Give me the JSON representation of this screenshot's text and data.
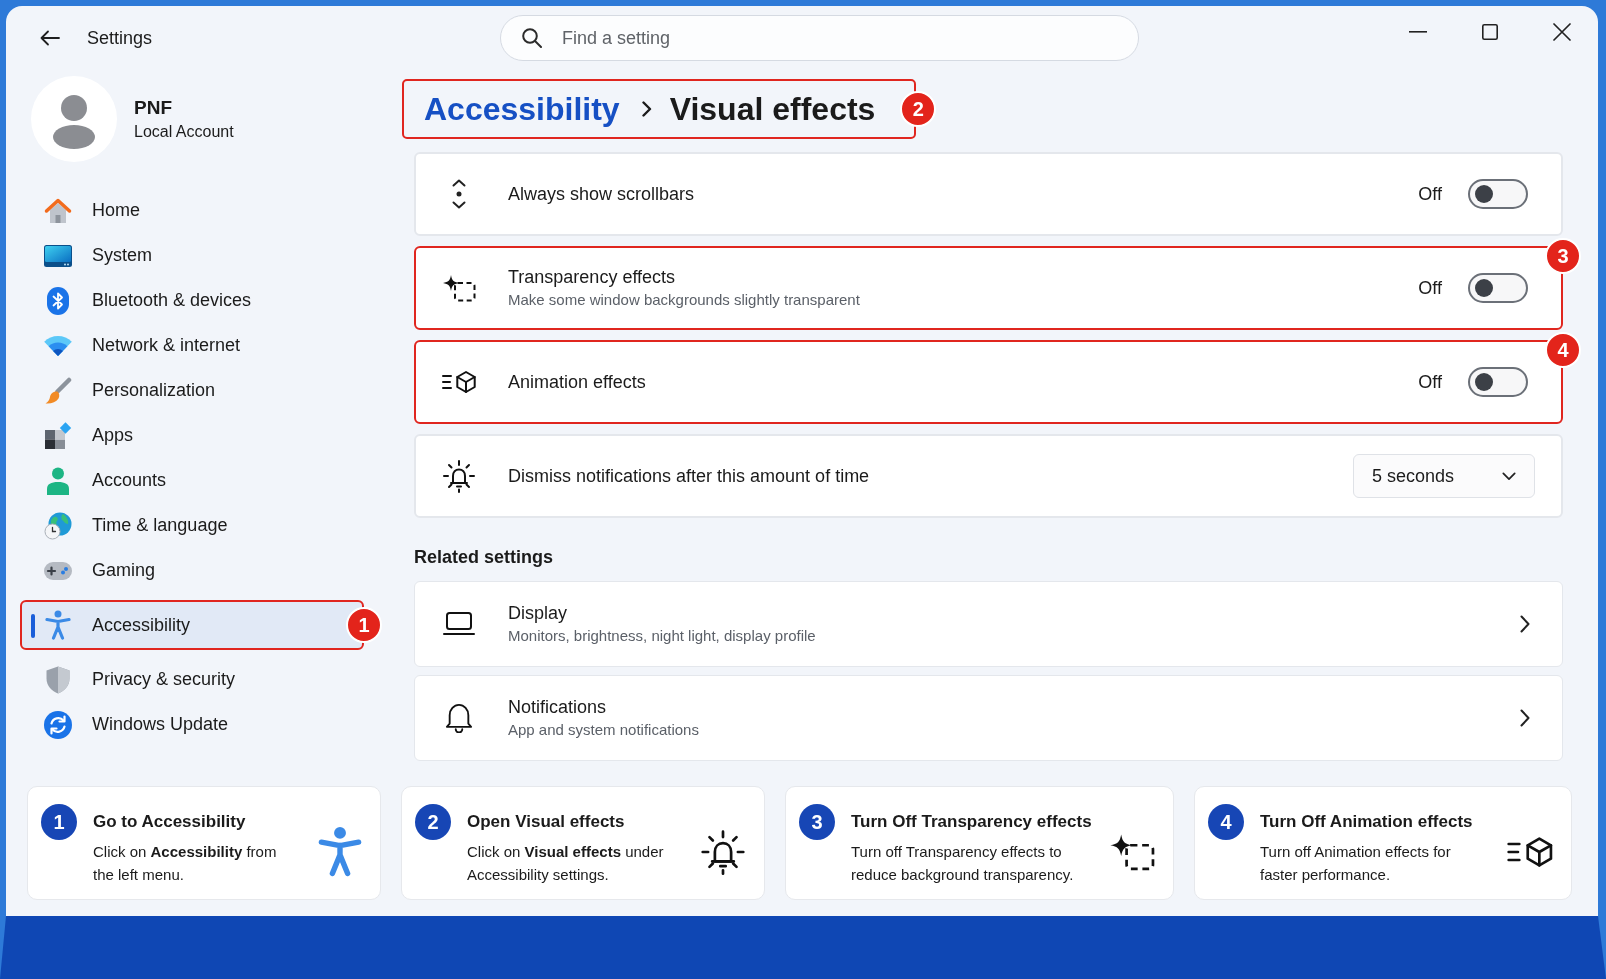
{
  "window": {
    "title": "Settings"
  },
  "search": {
    "placeholder": "Find a setting"
  },
  "account": {
    "name": "PNF",
    "type": "Local Account"
  },
  "sidebar": {
    "items": [
      {
        "label": "Home",
        "selected": false,
        "highlighted": false
      },
      {
        "label": "System",
        "selected": false,
        "highlighted": false
      },
      {
        "label": "Bluetooth & devices",
        "selected": false,
        "highlighted": false
      },
      {
        "label": "Network & internet",
        "selected": false,
        "highlighted": false
      },
      {
        "label": "Personalization",
        "selected": false,
        "highlighted": false
      },
      {
        "label": "Apps",
        "selected": false,
        "highlighted": false
      },
      {
        "label": "Accounts",
        "selected": false,
        "highlighted": false
      },
      {
        "label": "Time & language",
        "selected": false,
        "highlighted": false
      },
      {
        "label": "Gaming",
        "selected": false,
        "highlighted": false
      },
      {
        "label": "Accessibility",
        "selected": true,
        "highlighted": true,
        "step_badge": "1"
      },
      {
        "label": "Privacy & security",
        "selected": false,
        "highlighted": false
      },
      {
        "label": "Windows Update",
        "selected": false,
        "highlighted": false
      }
    ]
  },
  "breadcrumb": {
    "parent": "Accessibility",
    "current": "Visual effects",
    "highlighted": true,
    "step_badge": "2"
  },
  "settings": [
    {
      "kind": "toggle",
      "title": "Always show scrollbars",
      "state_label": "Off",
      "on": false,
      "highlighted": false
    },
    {
      "kind": "toggle",
      "title": "Transparency effects",
      "description": "Make some window backgrounds slightly transparent",
      "state_label": "Off",
      "on": false,
      "highlighted": true,
      "step_badge": "3"
    },
    {
      "kind": "toggle",
      "title": "Animation effects",
      "state_label": "Off",
      "on": false,
      "highlighted": true,
      "step_badge": "4"
    },
    {
      "kind": "dropdown",
      "title": "Dismiss notifications after this amount of time",
      "value": "5 seconds",
      "highlighted": false
    }
  ],
  "related_settings": {
    "heading": "Related settings",
    "items": [
      {
        "title": "Display",
        "description": "Monitors, brightness, night light, display profile"
      },
      {
        "title": "Notifications",
        "description": "App and system notifications"
      }
    ]
  },
  "steps": [
    {
      "number": "1",
      "title": "Go to Accessibility",
      "text": "Click on **Accessibility** from the left menu."
    },
    {
      "number": "2",
      "title": "Open Visual effects",
      "text": "Click on **Visual effects** under Accessibility settings."
    },
    {
      "number": "3",
      "title": "Turn Off Transparency effects",
      "text": "Turn off Transparency effects to reduce background transparency."
    },
    {
      "number": "4",
      "title": "Turn Off Animation effects",
      "text": "Turn off Animation effects for faster performance."
    }
  ]
}
